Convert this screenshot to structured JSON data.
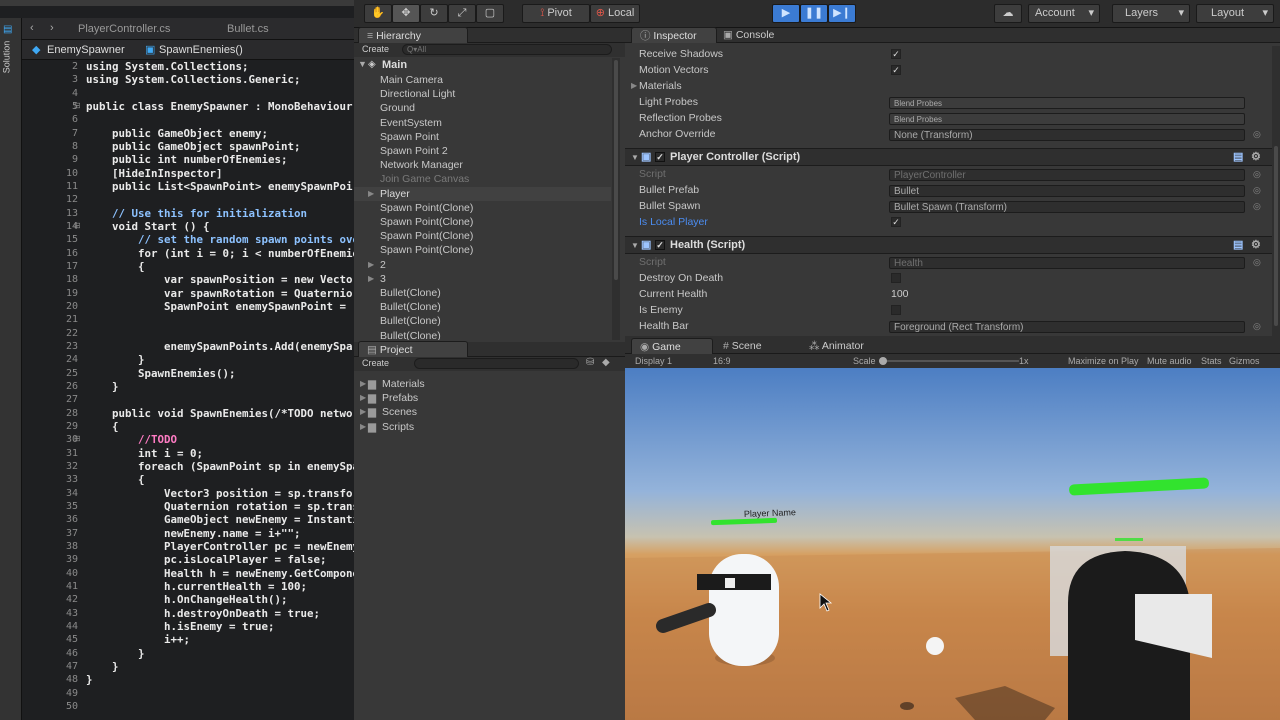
{
  "editor": {
    "tabs": [
      "PlayerController.cs",
      "Bullet.cs"
    ],
    "breadcrumb": [
      "EnemySpawner",
      "SpawnEnemies()"
    ],
    "side_label": "Solution",
    "line_numbers": [
      "2",
      "3",
      "4",
      "5",
      "6",
      "7",
      "8",
      "9",
      "10",
      "11",
      "12",
      "13",
      "14",
      "15",
      "16",
      "17",
      "18",
      "19",
      "20",
      "21",
      "22",
      "23",
      "24",
      "25",
      "26",
      "27",
      "28",
      "29",
      "30",
      "31",
      "32",
      "33",
      "34",
      "35",
      "36",
      "37",
      "38",
      "39",
      "40",
      "41",
      "42",
      "43",
      "44",
      "45",
      "46",
      "47",
      "48",
      "49",
      "50"
    ],
    "lines": [
      "using System.Collections;",
      "using System.Collections.Generic;",
      "",
      "public class EnemySpawner : MonoBehaviour",
      "",
      "    public GameObject enemy;",
      "    public GameObject spawnPoint;",
      "    public int numberOfEnemies;",
      "    [HideInInspector]",
      "    public List<SpawnPoint> enemySpawnPoir",
      "",
      "    // Use this for initialization",
      "    void Start () {",
      "        // set the random spawn points ove",
      "        for (int i = 0; i < numberOfEnemie",
      "        {",
      "            var spawnPosition = new Vector",
      "            var spawnRotation = Quaternior",
      "            SpawnPoint enemySpawnPoint = (",
      "",
      "",
      "            enemySpawnPoints.Add(enemySpa",
      "        }",
      "        SpawnEnemies();",
      "    }",
      "",
      "    public void SpawnEnemies(/*TODO networ",
      "    {",
      "        //TODO",
      "        int i = 0;",
      "        foreach (SpawnPoint sp in enemySpa",
      "        {",
      "            Vector3 position = sp.transfor",
      "            Quaternion rotation = sp.trans",
      "            GameObject newEnemy = Instanti",
      "            newEnemy.name = i+\"\";",
      "            PlayerController pc = newEnemy",
      "            pc.isLocalPlayer = false;",
      "            Health h = newEnemy.GetCompone",
      "            h.currentHealth = 100;",
      "            h.OnChangeHealth();",
      "            h.destroyOnDeath = true;",
      "            h.isEnemy = true;",
      "            i++;",
      "        }",
      "    }",
      "}",
      "",
      ""
    ]
  },
  "toolbar": {
    "pivot": "Pivot",
    "local": "Local",
    "account": "Account",
    "layers": "Layers",
    "layout": "Layout"
  },
  "hierarchy": {
    "title": "Hierarchy",
    "create": "Create",
    "search_placeholder": "Q▾All",
    "scene": "Main",
    "items": [
      "Main Camera",
      "Directional Light",
      "Ground",
      "EventSystem",
      "Spawn Point",
      "Spawn Point 2",
      "Network Manager",
      "Join Game Canvas",
      "Player",
      "Spawn Point(Clone)",
      "Spawn Point(Clone)",
      "Spawn Point(Clone)",
      "Spawn Point(Clone)",
      "2",
      "3",
      "Bullet(Clone)",
      "Bullet(Clone)",
      "Bullet(Clone)",
      "Bullet(Clone)"
    ]
  },
  "project": {
    "title": "Project",
    "create": "Create",
    "folders": [
      "Materials",
      "Prefabs",
      "Scenes",
      "Scripts"
    ]
  },
  "inspector": {
    "tab": "Inspector",
    "console_tab": "Console",
    "mesh_rows": [
      {
        "label": "Receive Shadows",
        "type": "check",
        "value": "✓"
      },
      {
        "label": "Motion Vectors",
        "type": "check",
        "value": "✓"
      },
      {
        "label": "Materials",
        "type": "fold",
        "value": ""
      },
      {
        "label": "Light Probes",
        "type": "select",
        "value": "Blend Probes"
      },
      {
        "label": "Reflection Probes",
        "type": "select",
        "value": "Blend Probes"
      },
      {
        "label": "Anchor Override",
        "type": "field",
        "value": "None (Transform)"
      }
    ],
    "pc_header": "Player Controller (Script)",
    "pc_rows": [
      {
        "label": "Script",
        "value": "PlayerController",
        "dim": true
      },
      {
        "label": "Bullet Prefab",
        "value": "Bullet"
      },
      {
        "label": "Bullet Spawn",
        "value": "Bullet Spawn (Transform)"
      },
      {
        "label": "Is Local Player",
        "value": "✓",
        "check": true
      }
    ],
    "health_header": "Health (Script)",
    "health_rows": [
      {
        "label": "Script",
        "value": "Health",
        "dim": true
      },
      {
        "label": "Destroy On Death",
        "value": "",
        "check": true
      },
      {
        "label": "Current Health",
        "value": "100",
        "plain": true
      },
      {
        "label": "Is Enemy",
        "value": "",
        "check": true
      },
      {
        "label": "Health Bar",
        "value": "Foreground (Rect Transform)"
      }
    ]
  },
  "views": {
    "game_tab": "Game",
    "scene_tab": "Scene",
    "animator_tab": "Animator",
    "display": "Display 1",
    "aspect": "16:9",
    "scale_label": "Scale",
    "scale_value": "1x",
    "maximize": "Maximize on Play",
    "mute": "Mute audio",
    "stats": "Stats",
    "gizmos": "Gizmos"
  },
  "game": {
    "player_name": "Player Name"
  }
}
